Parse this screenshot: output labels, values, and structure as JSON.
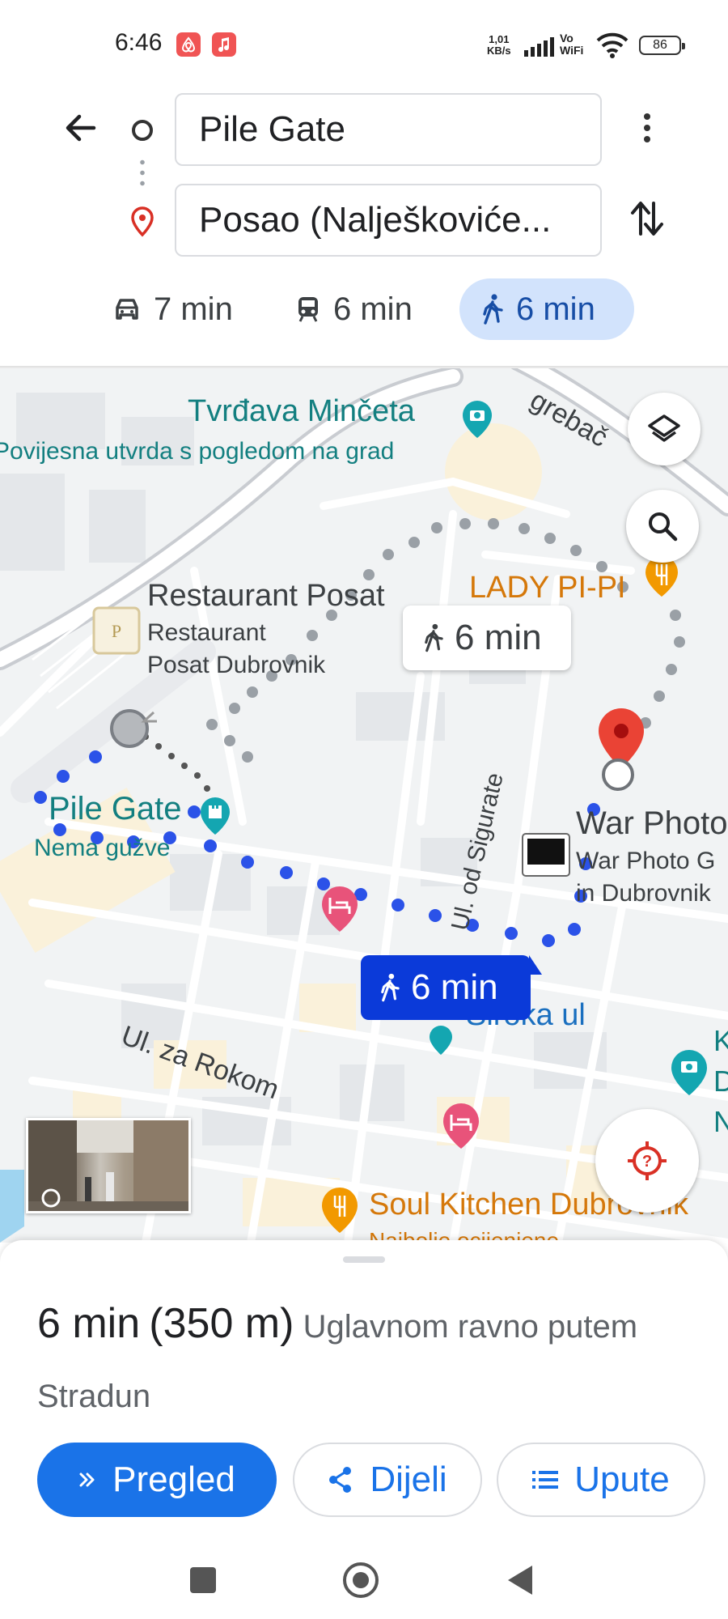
{
  "status_bar": {
    "time": "6:46",
    "net_speed_value": "1,01",
    "net_speed_unit": "KB/s",
    "vo": "Vo",
    "wifi_label": "WiFi",
    "battery": "86",
    "notification_icons": [
      "airbnb-icon",
      "music-icon"
    ]
  },
  "directions": {
    "origin": "Pile Gate",
    "destination": "Posao (Nalješkoviće...",
    "modes": [
      {
        "name": "car",
        "label": "7 min"
      },
      {
        "name": "transit",
        "label": "6 min"
      },
      {
        "name": "walk",
        "label": "6 min",
        "selected": true
      }
    ]
  },
  "map": {
    "labels": {
      "fortress": "Tvrđava Minčeta",
      "fortress_sub": "Povijesna utvrda s pogledom na grad",
      "restaurant": "Restaurant Posat",
      "restaurant_sub1": "Restaurant",
      "restaurant_sub2": "Posat Dubrovnik",
      "lady_pipi": "LADY PI-PI",
      "pile_gate": "Pile Gate",
      "pile_gate_sub": "Nema gužve",
      "street_sigurate": "Ul. od Sigurate",
      "war_photo": "War Photo",
      "war_photo_sub1": "War Photo G",
      "war_photo_sub2": "in Dubrovnik",
      "siroka": "Široka ul",
      "street_rokom": "Ul. za Rokom",
      "soul_kitchen": "Soul Kitchen Dubrovnik",
      "soul_kitchen_sub": "Najbolje ocijenjene",
      "grebac": "grebač",
      "right_k": "K",
      "right_d": "D",
      "right_n": "N"
    },
    "alt_route_time": "6 min",
    "route_time": "6 min",
    "colors": {
      "route": "#2b52e8",
      "alt_route": "#9aa0a6",
      "water": "#9fd4f0",
      "road": "#ffffff",
      "building": "#e6e8eb"
    }
  },
  "sheet": {
    "duration": "6 min",
    "distance": "(350 m)",
    "description": "Uglavnom ravno putem Stradun",
    "buttons": {
      "preview": "Pregled",
      "share": "Dijeli",
      "steps": "Upute"
    }
  }
}
